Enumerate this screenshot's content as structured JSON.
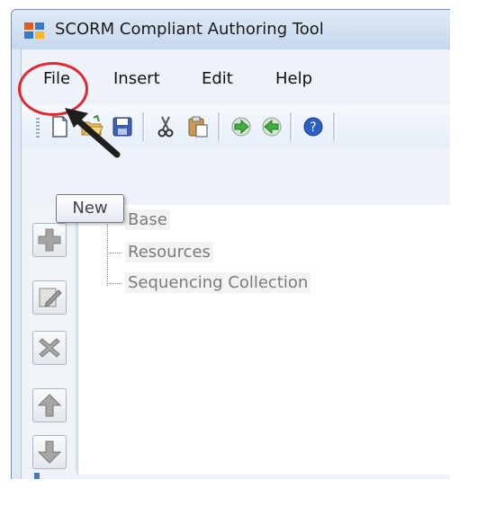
{
  "window": {
    "title": "SCORM Compliant Authoring Tool"
  },
  "menu": {
    "items": [
      {
        "label": "File"
      },
      {
        "label": "Insert"
      },
      {
        "label": "Edit"
      },
      {
        "label": "Help"
      }
    ]
  },
  "toolbar": {
    "buttons": [
      {
        "icon": "new-document-icon"
      },
      {
        "icon": "open-folder-icon"
      },
      {
        "icon": "save-icon"
      },
      {
        "icon": "cut-icon"
      },
      {
        "icon": "paste-icon"
      },
      {
        "icon": "forward-arrow-icon"
      },
      {
        "icon": "back-arrow-icon"
      },
      {
        "icon": "help-icon"
      }
    ]
  },
  "tooltip": {
    "text": "New"
  },
  "tree": {
    "nodes": [
      {
        "label": "Base"
      },
      {
        "label": "Resources"
      },
      {
        "label": "Sequencing Collection"
      }
    ]
  },
  "side_buttons": [
    {
      "icon": "add-icon"
    },
    {
      "icon": "edit-icon"
    },
    {
      "icon": "delete-icon"
    },
    {
      "icon": "move-up-icon"
    },
    {
      "icon": "move-down-icon"
    }
  ],
  "colors": {
    "highlight_ring": "#e3262f",
    "window_frame": "#c6d7ec",
    "accent": "#4c79b7"
  }
}
